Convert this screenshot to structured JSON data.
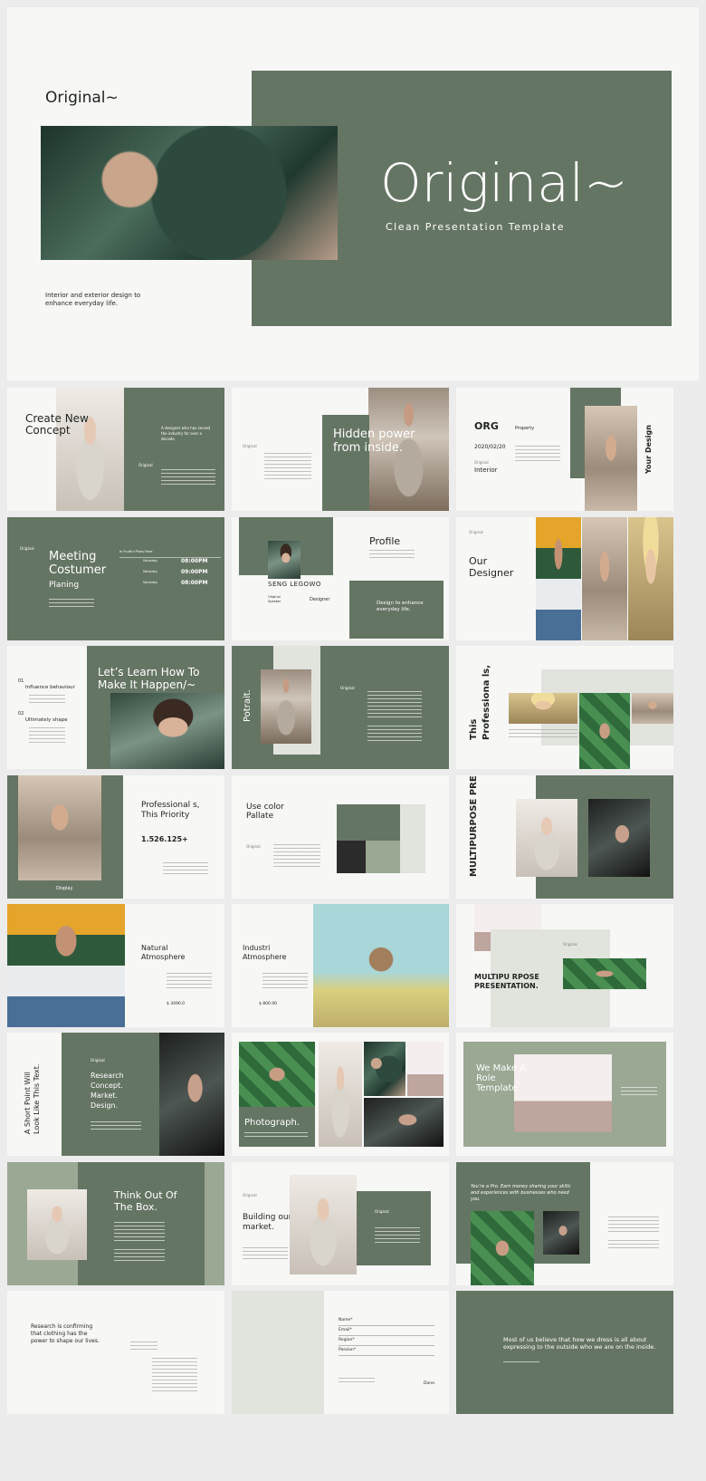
{
  "cover": {
    "brand": "Original~",
    "title": "Original~",
    "subtitle": "Clean Presentation Template",
    "tagline": "Interior and exterior design to enhance everyday life."
  },
  "s1": {
    "title": "Create New Concept",
    "quote": "A designer who has served the industry for over a decade.",
    "brand": "Original"
  },
  "s2": {
    "brand": "Original",
    "title": "Hidden power from inside."
  },
  "s3": {
    "org": "ORG",
    "property": "Property",
    "date": "2020/02/20",
    "brand": "Original",
    "interior": "Interior",
    "vertical": "Your Design"
  },
  "s4": {
    "brand": "Original",
    "title": "Meeting Costumer",
    "sub": "Planing",
    "heading": "In Fruitful Plans Here",
    "rows": [
      {
        "day": "Saturday",
        "time": "08:00PM"
      },
      {
        "day": "Saturday",
        "time": "09:00PM"
      },
      {
        "day": "Saturday",
        "time": "08:00PM"
      }
    ]
  },
  "s5": {
    "name": "SENG LEGOWO",
    "title": "Profile",
    "role1": "Original Speaker",
    "role2": "Designer",
    "quote": "Design to enhance everyday life."
  },
  "s6": {
    "brand": "Original",
    "title": "Our Designer"
  },
  "s7": {
    "n1": "01",
    "l1": "Influence behaviour",
    "n2": "02",
    "l2": "Ultimately shape",
    "title": "Let’s Learn How To Make It Happen/~"
  },
  "s8": {
    "vert": "Potrait.",
    "brand": "Original"
  },
  "s9": {
    "vert1": "This",
    "vert2": "Professiona ls,"
  },
  "s10": {
    "title": "Professional s, This Priority",
    "number": "1.526.125+",
    "caption": "Display"
  },
  "s11": {
    "title": "Use color Pallate",
    "brand": "Original"
  },
  "s12": {
    "vert": "MULTIPURPOSE PRESENTATION."
  },
  "s13": {
    "title": "Natural Atmosphere",
    "price": "$ 3490.0"
  },
  "s14": {
    "title": "Industri Atmosphere",
    "price": "$ 800.00"
  },
  "s15": {
    "brand": "Original",
    "title": "MULTIPU RPOSE PRESENTATION."
  },
  "s16": {
    "vert": "A Short Point Will Look Like This Text.",
    "brand": "Original",
    "list": "Research Concept. Market. Design."
  },
  "s17": {
    "title": "Photograph."
  },
  "s18": {
    "title": "We Make A Role Template"
  },
  "s19": {
    "title": "Think Out Of The Box."
  },
  "s20": {
    "brand": "Original",
    "title": "Building our market.",
    "brand2": "Original"
  },
  "s21": {
    "quote": "You’re a Pro. Earn money sharing your skills and experiences with businesses who need you."
  },
  "s22": {
    "text": "Research is confirming that clothing has the power to shape our lives."
  },
  "s23": {
    "fields": [
      "Name*",
      "Email*",
      "Region*",
      "Passion*"
    ],
    "done": "Done."
  },
  "s24": {
    "quote": "Most of us believe that how we dress is all about expressing to the outside who we are on the inside."
  }
}
